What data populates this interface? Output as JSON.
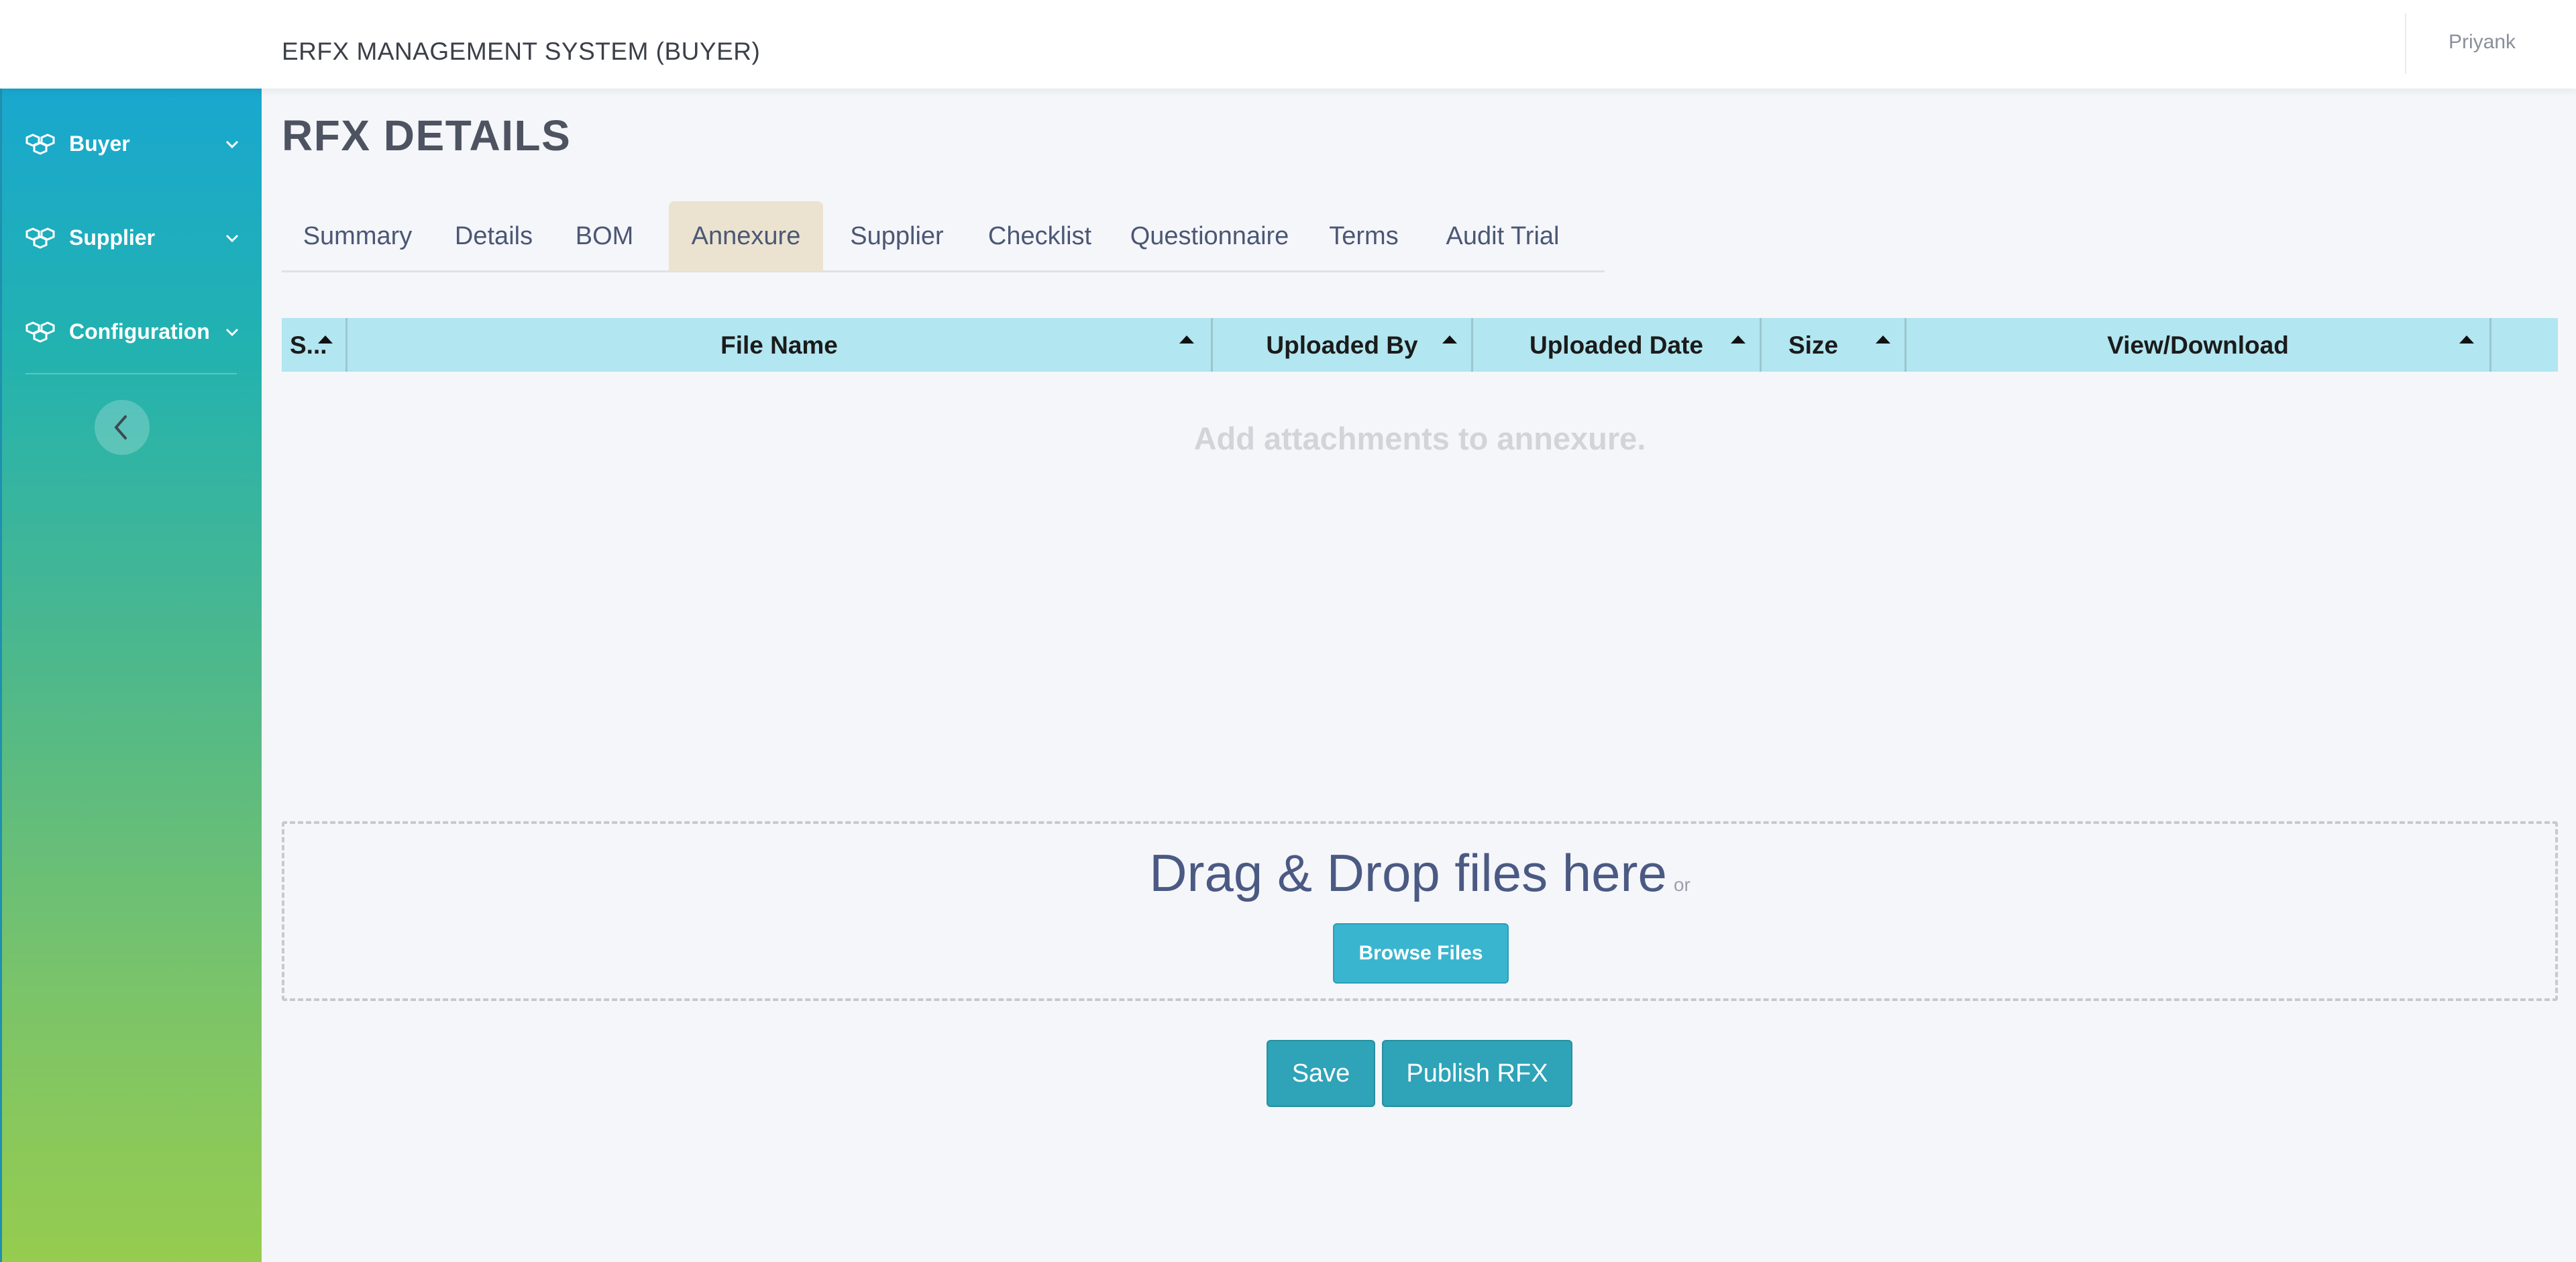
{
  "app": {
    "title": "ERFX MANAGEMENT SYSTEM (BUYER)",
    "user_name": "Priyank"
  },
  "sidebar": {
    "items": [
      {
        "label": "Buyer",
        "icon": "cubes-icon"
      },
      {
        "label": "Supplier",
        "icon": "cubes-icon"
      },
      {
        "label": "Configuration",
        "icon": "cubes-icon"
      }
    ],
    "collapse_icon": "chevron-left-icon"
  },
  "page": {
    "title": "RFX DETAILS"
  },
  "tabs": [
    {
      "label": "Summary"
    },
    {
      "label": "Details"
    },
    {
      "label": "BOM"
    },
    {
      "label": "Annexure",
      "active": true
    },
    {
      "label": "Supplier"
    },
    {
      "label": "Checklist"
    },
    {
      "label": "Questionnaire"
    },
    {
      "label": "Terms"
    },
    {
      "label": "Audit Trial"
    }
  ],
  "table": {
    "columns": [
      "S...",
      "File Name",
      "Uploaded By",
      "Uploaded Date",
      "Size",
      "View/Download"
    ],
    "empty_message": "Add attachments to annexure."
  },
  "upload": {
    "drop_text": "Drag & Drop files here",
    "or_text": "or",
    "browse_label": "Browse Files"
  },
  "actions": {
    "save_label": "Save",
    "publish_label": "Publish RFX"
  },
  "colors": {
    "table_header": "#b2e6f0",
    "primary_button": "#2fa3b8",
    "active_tab": "#ebe3d0"
  }
}
